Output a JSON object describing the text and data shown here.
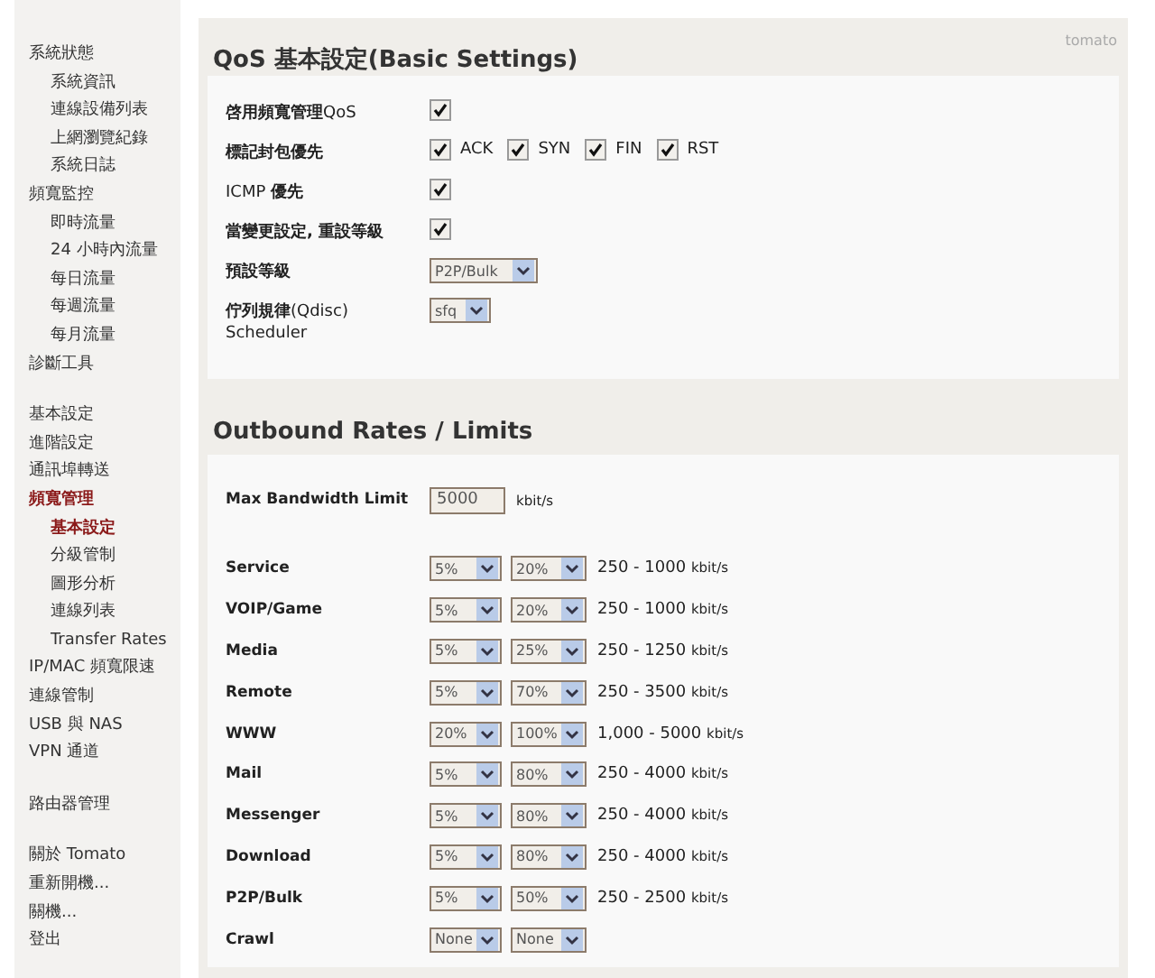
{
  "sidebar": {
    "groups": [
      [
        {
          "label": "系統狀態",
          "selected": false,
          "children": [
            {
              "label": "系統資訊",
              "selected": false
            },
            {
              "label": "連線設備列表",
              "selected": false
            },
            {
              "label": "上網瀏覽紀錄",
              "selected": false
            },
            {
              "label": "系統日誌",
              "selected": false
            }
          ]
        },
        {
          "label": "頻寬監控",
          "selected": false,
          "children": [
            {
              "label": "即時流量",
              "selected": false
            },
            {
              "label": "24 小時內流量",
              "selected": false
            },
            {
              "label": "每日流量",
              "selected": false
            },
            {
              "label": "每週流量",
              "selected": false
            },
            {
              "label": "每月流量",
              "selected": false
            }
          ]
        },
        {
          "label": "診斷工具",
          "selected": false
        }
      ],
      [
        {
          "label": "基本設定",
          "selected": false
        },
        {
          "label": "進階設定",
          "selected": false
        },
        {
          "label": "通訊埠轉送",
          "selected": false
        },
        {
          "label": "頻寬管理",
          "selected": true,
          "children": [
            {
              "label": "基本設定",
              "selected": true
            },
            {
              "label": "分級管制",
              "selected": false
            },
            {
              "label": "圖形分析",
              "selected": false
            },
            {
              "label": "連線列表",
              "selected": false
            },
            {
              "label": "Transfer Rates",
              "selected": false
            }
          ]
        },
        {
          "label": "IP/MAC 頻寬限速",
          "selected": false
        },
        {
          "label": "連線管制",
          "selected": false
        },
        {
          "label": "USB 與 NAS",
          "selected": false
        },
        {
          "label": "VPN 通道",
          "selected": false
        }
      ],
      [
        {
          "label": "路由器管理",
          "selected": false
        }
      ],
      [
        {
          "label": "關於 Tomato",
          "selected": false
        },
        {
          "label": "重新開機...",
          "selected": false
        },
        {
          "label": "關機...",
          "selected": false
        },
        {
          "label": "登出",
          "selected": false
        }
      ]
    ]
  },
  "brand": "tomato",
  "basic_settings": {
    "title": "QoS 基本設定(Basic Settings)",
    "rows": [
      {
        "kind": "checkbox",
        "label": "**啓用頻寬管理**QoS",
        "checked": true
      },
      {
        "kind": "checkboxes",
        "label": "**標記封包優先**",
        "options": [
          {
            "label": "ACK",
            "checked": true
          },
          {
            "label": "SYN",
            "checked": true
          },
          {
            "label": "FIN",
            "checked": true
          },
          {
            "label": "RST",
            "checked": true
          }
        ]
      },
      {
        "kind": "checkbox",
        "label": "ICMP **優先**",
        "checked": true
      },
      {
        "kind": "checkbox",
        "label": "**當變更設定, 重設等級**",
        "checked": true
      },
      {
        "kind": "select",
        "label": "**預設等級**",
        "value": "P2P/Bulk"
      },
      {
        "kind": "select",
        "label": "**佇列規律**(Qdisc) Scheduler",
        "value": "sfq"
      }
    ]
  },
  "outbound": {
    "title": "Outbound Rates / Limits",
    "max_bandwidth": {
      "label": "Max Bandwidth Limit",
      "value": "5000",
      "unit": "kbit/s"
    },
    "classes": [
      {
        "name": "Service",
        "min": "5%",
        "max": "20%",
        "range": "250 - 1000",
        "unit": "kbit/s"
      },
      {
        "name": "VOIP/Game",
        "min": "5%",
        "max": "20%",
        "range": "250 - 1000",
        "unit": "kbit/s"
      },
      {
        "name": "Media",
        "min": "5%",
        "max": "25%",
        "range": "250 - 1250",
        "unit": "kbit/s"
      },
      {
        "name": "Remote",
        "min": "5%",
        "max": "70%",
        "range": "250 - 3500",
        "unit": "kbit/s"
      },
      {
        "name": "WWW",
        "min": "20%",
        "max": "100%",
        "range": "1,000 - 5000",
        "unit": "kbit/s"
      },
      {
        "name": "Mail",
        "min": "5%",
        "max": "80%",
        "range": "250 - 4000",
        "unit": "kbit/s"
      },
      {
        "name": "Messenger",
        "min": "5%",
        "max": "80%",
        "range": "250 - 4000",
        "unit": "kbit/s"
      },
      {
        "name": "Download",
        "min": "5%",
        "max": "80%",
        "range": "250 - 4000",
        "unit": "kbit/s"
      },
      {
        "name": "P2P/Bulk",
        "min": "5%",
        "max": "50%",
        "range": "250 - 2500",
        "unit": "kbit/s"
      },
      {
        "name": "Crawl",
        "min": "None",
        "max": "None"
      }
    ]
  }
}
